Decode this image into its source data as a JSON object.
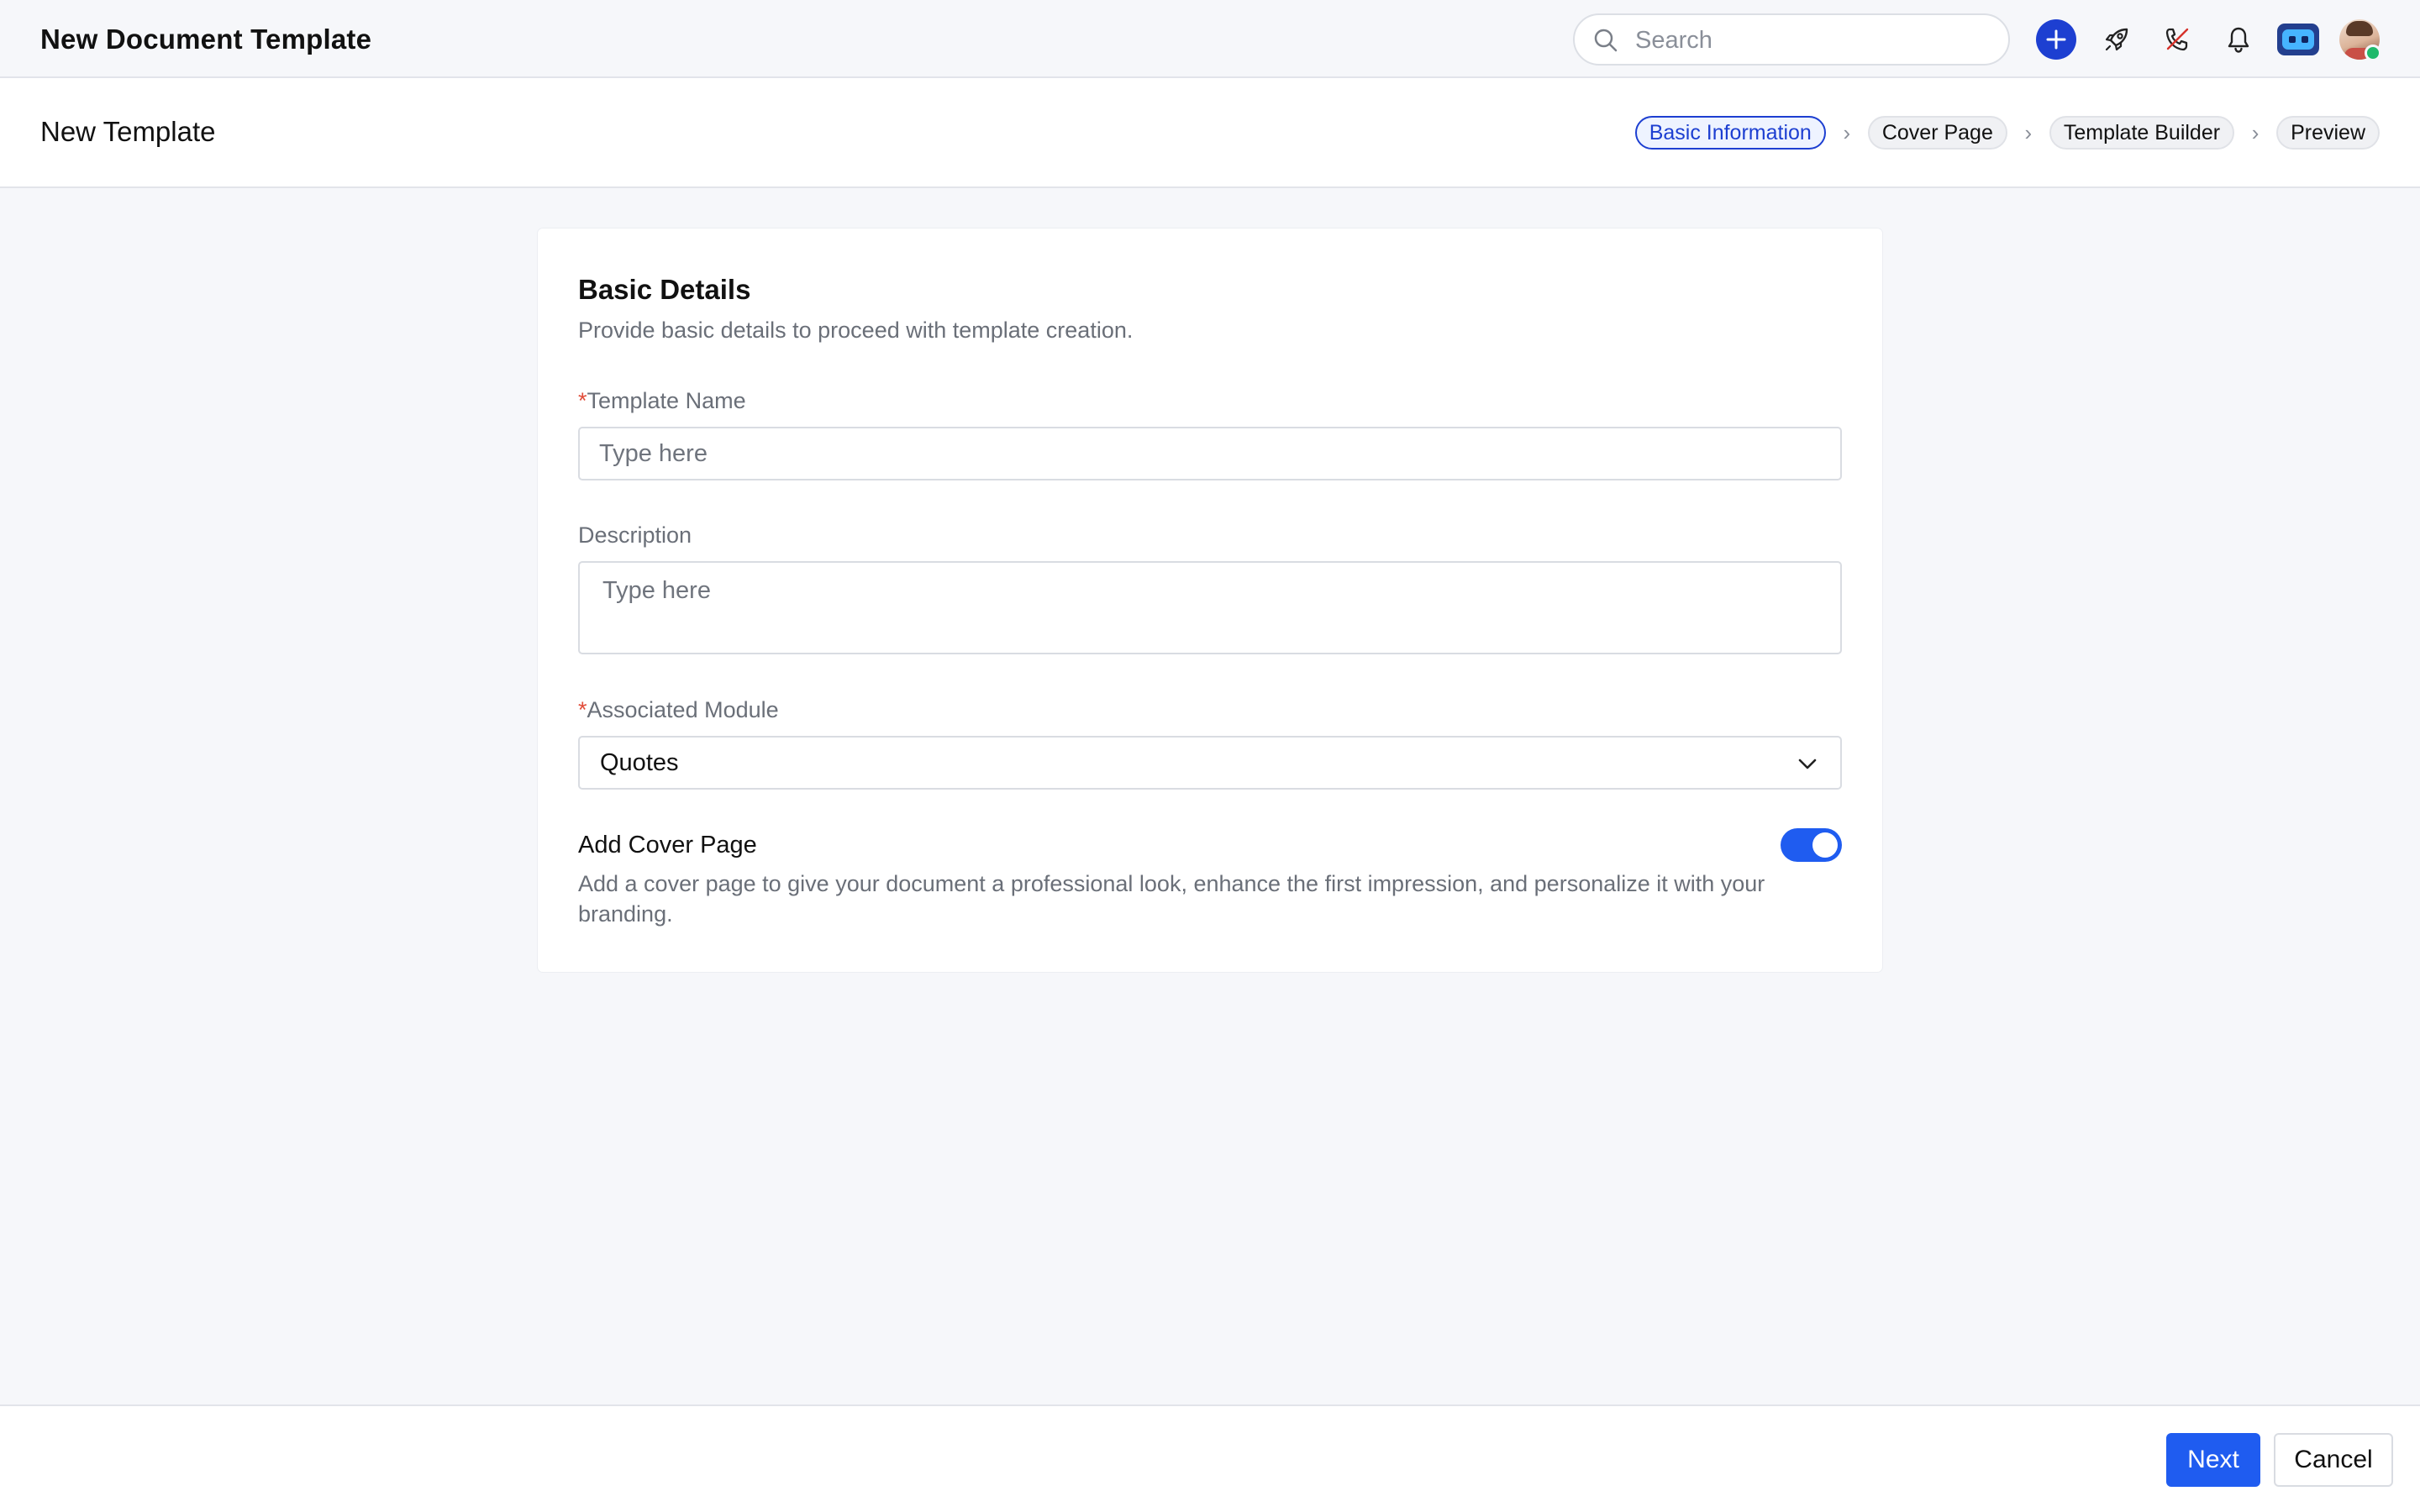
{
  "app": {
    "title": "New Document Template"
  },
  "topbar": {
    "search_placeholder": "Search",
    "icons": [
      "search-icon",
      "plus-icon",
      "rocket-icon",
      "missed-call-icon",
      "bell-icon",
      "bot-icon",
      "avatar"
    ],
    "accent_color": "#1d3fd1"
  },
  "page": {
    "title": "New Template"
  },
  "steps": [
    {
      "label": "Basic Information",
      "active": true
    },
    {
      "label": "Cover Page",
      "active": false
    },
    {
      "label": "Template Builder",
      "active": false
    },
    {
      "label": "Preview",
      "active": false
    }
  ],
  "form": {
    "title": "Basic Details",
    "subtitle": "Provide basic details to proceed with template creation.",
    "required_marker": "*",
    "template_name": {
      "label": "Template Name",
      "placeholder": "Type here",
      "value": ""
    },
    "description": {
      "label": "Description",
      "placeholder": "Type here",
      "value": ""
    },
    "associated_module": {
      "label": "Associated Module",
      "value": "Quotes"
    },
    "cover_page": {
      "title": "Add Cover Page",
      "description": "Add a cover page to give your document a professional look, enhance the first impression, and personalize it with your branding.",
      "enabled": true
    }
  },
  "footer": {
    "next_label": "Next",
    "cancel_label": "Cancel",
    "primary_color": "#1f5cf0"
  }
}
